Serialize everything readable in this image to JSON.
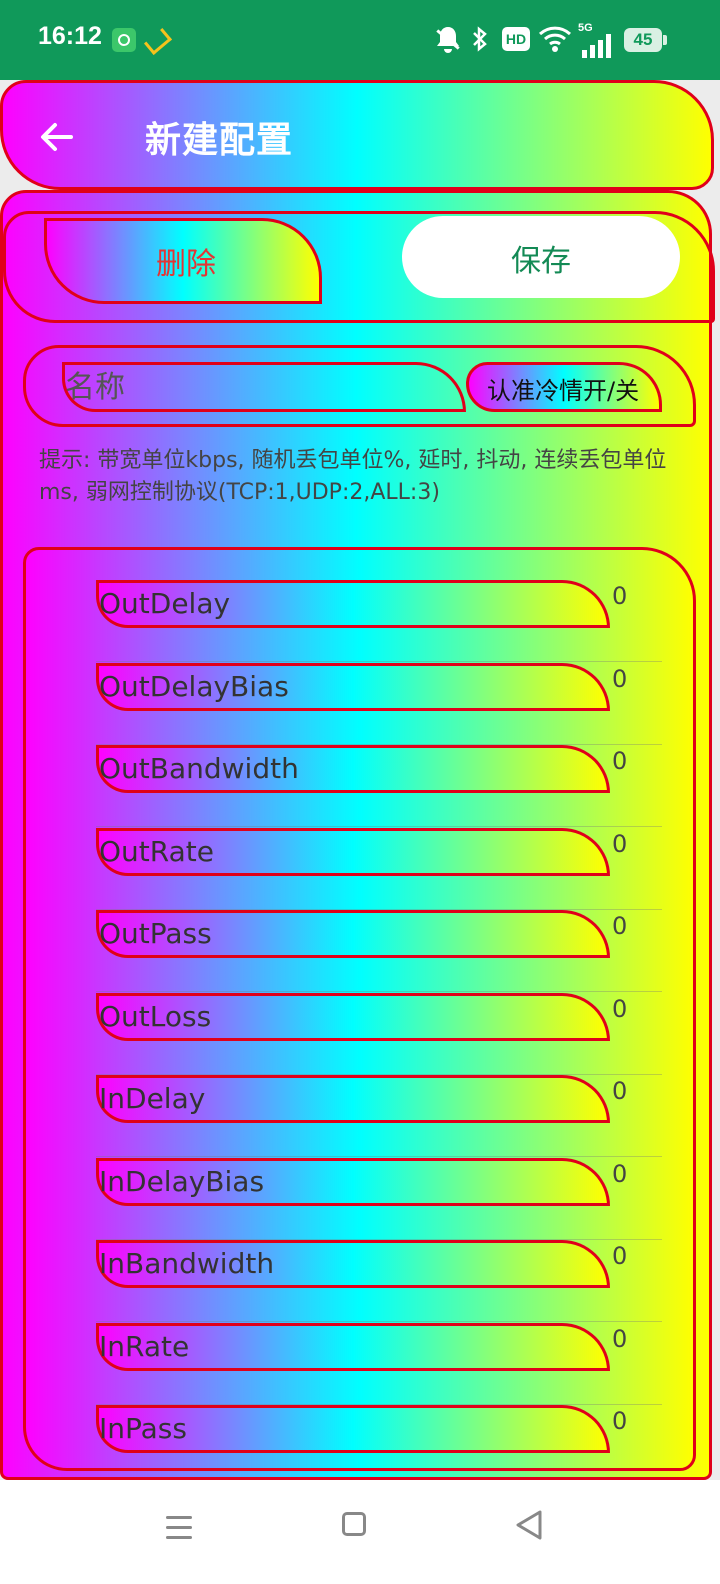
{
  "status_bar": {
    "time": "16:12",
    "network": "5G",
    "hd_label": "HD",
    "battery": "45",
    "icons": [
      "app-update-icon",
      "app-logo-icon",
      "bell-off-icon",
      "bluetooth-icon",
      "wifi-icon",
      "signal-icon"
    ]
  },
  "app_bar": {
    "title": "新建配置",
    "back_icon": "arrow-left-icon"
  },
  "actions": {
    "delete_label": "删除",
    "save_label": "保存"
  },
  "name_row": {
    "placeholder": "名称",
    "toggle_label": "认准冷情开/关"
  },
  "hint": "提示: 带宽单位kbps, 随机丢包单位%, 延时, 抖动, 连续丢包单位ms, 弱网控制协议(TCP:1,UDP:2,ALL:3)",
  "params": [
    {
      "name": "OutDelay",
      "value": "0"
    },
    {
      "name": "OutDelayBias",
      "value": "0"
    },
    {
      "name": "OutBandwidth",
      "value": "0"
    },
    {
      "name": "OutRate",
      "value": "0"
    },
    {
      "name": "OutPass",
      "value": "0"
    },
    {
      "name": "OutLoss",
      "value": "0"
    },
    {
      "name": "InDelay",
      "value": "0"
    },
    {
      "name": "InDelayBias",
      "value": "0"
    },
    {
      "name": "InBandwidth",
      "value": "0"
    },
    {
      "name": "InRate",
      "value": "0"
    },
    {
      "name": "InPass",
      "value": "0"
    }
  ],
  "nav_bar": {
    "icons": [
      "menu-icon",
      "home-square-icon",
      "back-triangle-icon"
    ]
  },
  "colors": {
    "status_bar_bg": "#10995a",
    "delete_text": "#e33535",
    "save_text": "#138a55",
    "outline_red": "#e0001a"
  }
}
